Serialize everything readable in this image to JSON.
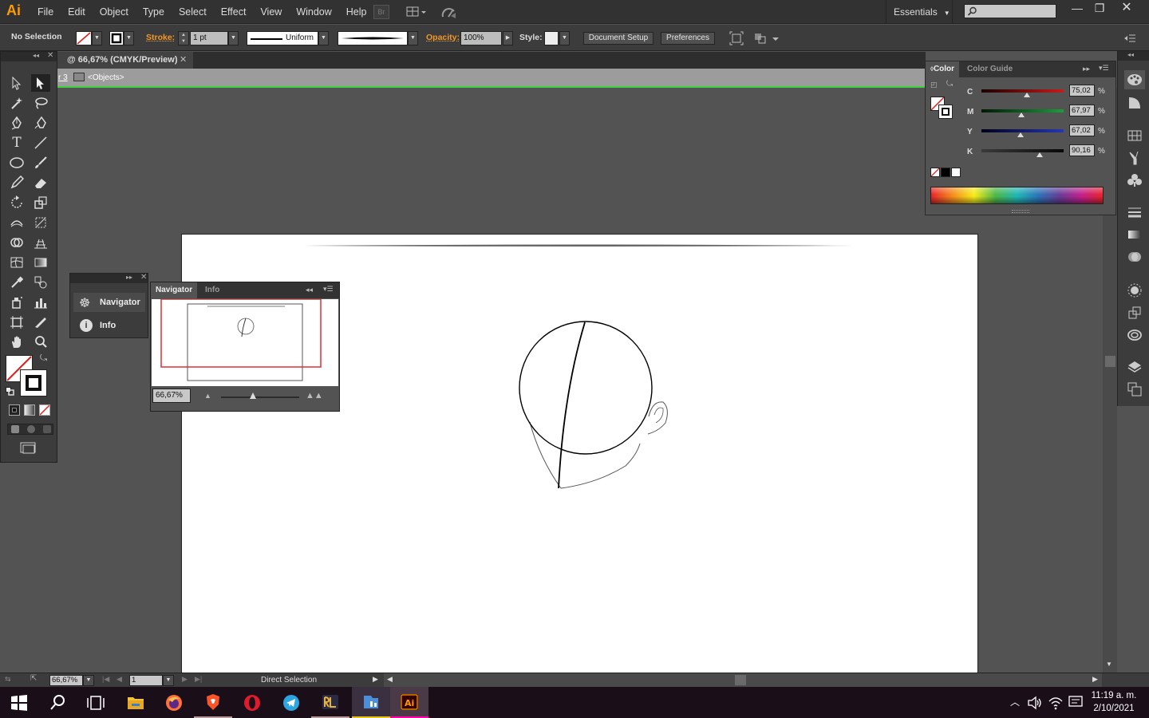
{
  "app": {
    "logo": "Ai",
    "bridge_label": "Br"
  },
  "menu": [
    "File",
    "Edit",
    "Object",
    "Type",
    "Select",
    "Effect",
    "View",
    "Window",
    "Help"
  ],
  "workspace": "Essentials",
  "control_bar": {
    "selection": "No Selection",
    "stroke_label": "Stroke:",
    "stroke_weight": "1 pt",
    "stroke_profile": "Uniform",
    "opacity_label": "Opacity:",
    "opacity_value": "100%",
    "style_label": "Style:",
    "document_setup": "Document Setup",
    "preferences": "Preferences"
  },
  "document_tab": {
    "title": "@ 66,67% (CMYK/Preview)"
  },
  "breadcrumb": {
    "layer": "r 3",
    "group": "<Objects>"
  },
  "color_panel": {
    "tabs": [
      "Color",
      "Color Guide"
    ],
    "sliders": [
      {
        "label": "C",
        "value": "75,02",
        "pct": "%",
        "pos": 0.75,
        "color": "#c61b1b"
      },
      {
        "label": "M",
        "value": "67,97",
        "pct": "%",
        "pos": 0.68,
        "color": "#1a9d3b"
      },
      {
        "label": "Y",
        "value": "67,02",
        "pct": "%",
        "pos": 0.67,
        "color": "#2736b5"
      },
      {
        "label": "K",
        "value": "90,16",
        "pct": "%",
        "pos": 0.9,
        "color": "#999999"
      }
    ]
  },
  "navigator_collapsed": {
    "items": [
      "Navigator",
      "Info"
    ]
  },
  "navigator_panel": {
    "tabs": [
      "Navigator",
      "Info"
    ],
    "zoom": "66,67%"
  },
  "status_bar": {
    "zoom": "66,67%",
    "artboard": "1",
    "tool": "Direct Selection"
  },
  "taskbar": {
    "time": "11:19 a. m.",
    "date": "2/10/2021"
  },
  "colors": {
    "accent": "#ff9a00",
    "guide_green": "#3ed43e"
  }
}
